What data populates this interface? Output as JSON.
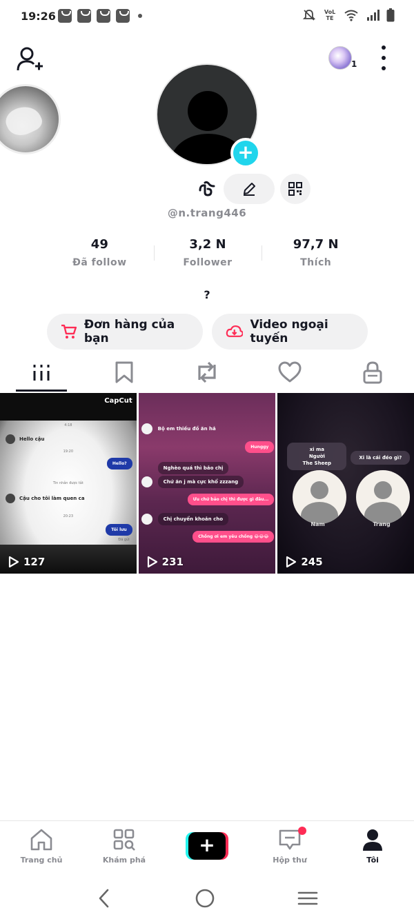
{
  "status_bar": {
    "time": "19:26",
    "volte_label": "VoLTE"
  },
  "top_bar": {
    "notification_count": "1"
  },
  "profile": {
    "username": "@n.trang446",
    "bio": "?",
    "stats": [
      {
        "value": "49",
        "label": "Đã follow"
      },
      {
        "value": "3,2 N",
        "label": "Follower"
      },
      {
        "value": "97,7 N",
        "label": "Thích"
      }
    ]
  },
  "actions": {
    "orders_label": "Đơn hàng của bạn",
    "offline_label": "Video ngoại tuyến"
  },
  "tabs": [
    "videos",
    "saved",
    "reposts",
    "liked",
    "private"
  ],
  "videos": [
    {
      "views": "127",
      "watermark": "CapCut",
      "chat": {
        "msg1": "Hello cậu",
        "time1": "19:20",
        "reply1": "Hello?",
        "system": "Tin nhắn được tắt",
        "msg2": "Cậu cho tôi làm quen ca",
        "time2": "20:23",
        "reply2": "Tôi lưu",
        "seen": "Đã gửi",
        "time0": "4:18"
      }
    },
    {
      "views": "231",
      "chat": {
        "msg1": "Bộ em thiếu đồ ăn hả",
        "reply1": "Hunggy",
        "msg2": "Nghèo quá thì bảo chị",
        "msg3": "Chứ ăn j mà cực khổ zzzang",
        "reply2": "Ưu chứ bảo chị thì được gì đâu...",
        "msg4": "Chị chuyển khoản cho",
        "reply3": "Chồng ơi em yêu chồng 😂😂😂"
      }
    },
    {
      "views": "245",
      "chat": {
        "label1_line1": "xi ma",
        "label1_line2": "Người",
        "label1_line3": "The Sheep",
        "label2": "Xi là cái đéo gì?",
        "person1": "Nam",
        "person2": "Trang"
      }
    }
  ],
  "bottom_nav": [
    {
      "label": "Trang chủ",
      "icon": "home-icon"
    },
    {
      "label": "Khám phá",
      "icon": "discover-icon"
    },
    {
      "label": "",
      "icon": "create-icon"
    },
    {
      "label": "Hộp thư",
      "icon": "inbox-icon"
    },
    {
      "label": "Tôi",
      "icon": "profile-icon"
    }
  ],
  "colors": {
    "accent_cyan": "#20d5ec",
    "tiktok_red": "#fe2c55",
    "tiktok_cyan": "#25f4ee",
    "text_primary": "#161823",
    "text_secondary": "#8a8b91"
  }
}
